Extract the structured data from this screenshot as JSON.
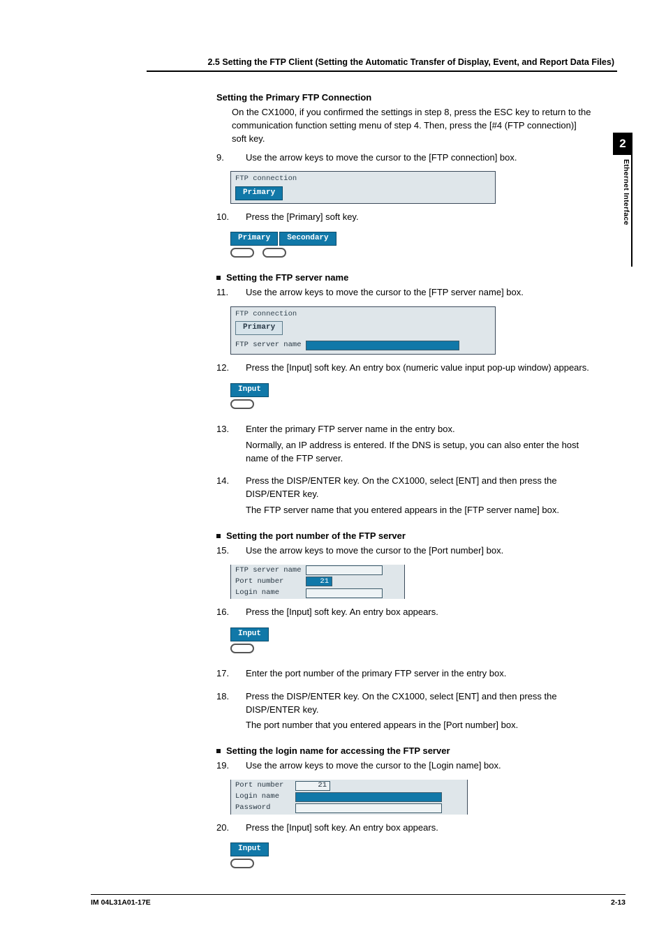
{
  "section_header": "2.5  Setting the FTP Client (Setting the Automatic Transfer of Display, Event, and Report Data Files)",
  "side_tab": {
    "chapter_number": "2",
    "tab_label": "Ethernet Interface"
  },
  "footer": {
    "doc_id": "IM 04L31A01-17E",
    "page": "2-13"
  },
  "h_primary": "Setting the Primary FTP Connection",
  "intro_para": "On the CX1000, if you confirmed the settings in step 8, press the ESC key to return to the communication function setting menu of step 4.  Then, press the [#4 (FTP connection)] soft key.",
  "step9": {
    "num": "9.",
    "text": "Use the arrow keys to move the cursor to the [FTP connection] box."
  },
  "fig9": {
    "group": "FTP connection",
    "chip": "Primary"
  },
  "step10": {
    "num": "10.",
    "text": "Press the [Primary] soft key."
  },
  "fig10": {
    "chip1": "Primary",
    "chip2": "Secondary"
  },
  "h_server_name": "Setting the FTP server name",
  "step11": {
    "num": "11.",
    "text": "Use the arrow keys to move the cursor to the [FTP server name] box."
  },
  "fig11": {
    "group": "FTP connection",
    "chip": "Primary",
    "row_label": "FTP server name"
  },
  "step12": {
    "num": "12.",
    "text": "Press the [Input] soft key.  An entry box (numeric value input pop-up window) appears."
  },
  "fig12": {
    "chip": "Input"
  },
  "step13": {
    "num": "13.",
    "line1": "Enter the primary FTP server name in the entry box.",
    "line2": "Normally, an IP address is entered.  If the DNS is setup, you can also enter the host name of the FTP server."
  },
  "step14": {
    "num": "14.",
    "line1": "Press the DISP/ENTER key.  On the CX1000, select [ENT] and then press the DISP/ENTER key.",
    "line2": "The FTP server name that you entered appears in the [FTP server name] box."
  },
  "h_port": "Setting the port number of the FTP server",
  "step15": {
    "num": "15.",
    "text": "Use the arrow keys to move the cursor to the [Port number] box."
  },
  "fig15": {
    "row1_label": "FTP server name",
    "row2_label": "Port number",
    "row2_value": "21",
    "row3_label": "Login name"
  },
  "step16": {
    "num": "16.",
    "text": "Press the [Input] soft key.  An entry box appears."
  },
  "fig16": {
    "chip": "Input"
  },
  "step17": {
    "num": "17.",
    "text": "Enter the port number of the primary FTP server in the entry box."
  },
  "step18": {
    "num": "18.",
    "line1": "Press the DISP/ENTER key.  On the CX1000, select [ENT] and then press the DISP/ENTER key.",
    "line2": "The port number that you entered appears in the [Port number] box."
  },
  "h_login": "Setting the login name for accessing the FTP server",
  "step19": {
    "num": "19.",
    "text": "Use the arrow keys to move the cursor to the [Login name] box."
  },
  "fig19": {
    "row1_label": "Port number",
    "row1_value": "21",
    "row2_label": "Login name",
    "row3_label": "Password"
  },
  "step20": {
    "num": "20.",
    "text": "Press the [Input] soft key.  An entry box appears."
  },
  "fig20": {
    "chip": "Input"
  }
}
